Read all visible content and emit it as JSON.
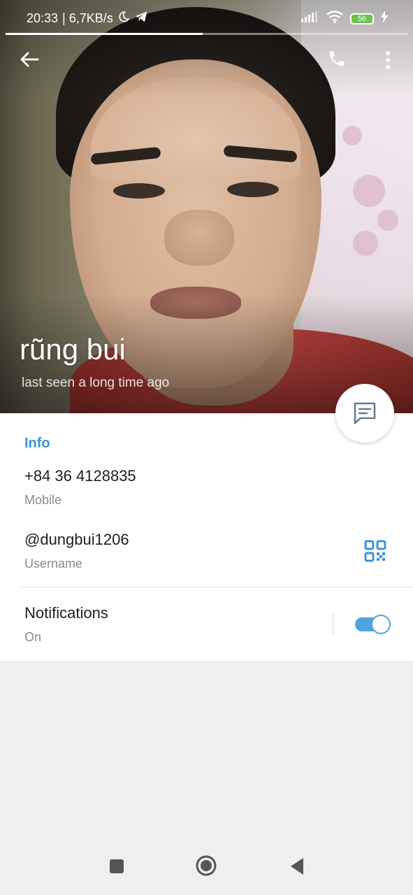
{
  "status_bar": {
    "time": "20:33",
    "speed": "| 6,7KB/s",
    "battery": "56",
    "icons": [
      "moon-icon",
      "telegram-icon",
      "signal-icon",
      "wifi-icon",
      "battery-icon",
      "charging-icon"
    ]
  },
  "story_progress": 0.49,
  "topbar": {
    "icons": [
      "back-arrow-icon",
      "phone-icon",
      "more-vert-icon"
    ]
  },
  "profile": {
    "name": "rũng bui",
    "status": "last seen a long time ago"
  },
  "info": {
    "title": "Info",
    "phone_value": "+84 36 4128835",
    "phone_label": "Mobile",
    "username_value": "@dungbui1206",
    "username_label": "Username",
    "notifications_value": "Notifications",
    "notifications_label": "On",
    "notifications_on": true
  },
  "colors": {
    "accent": "#3a95d5",
    "toggle": "#4fa4e0",
    "background": "#efefef"
  },
  "navbar": {
    "icons": [
      "recents-square-icon",
      "home-circle-icon",
      "back-triangle-icon"
    ]
  }
}
